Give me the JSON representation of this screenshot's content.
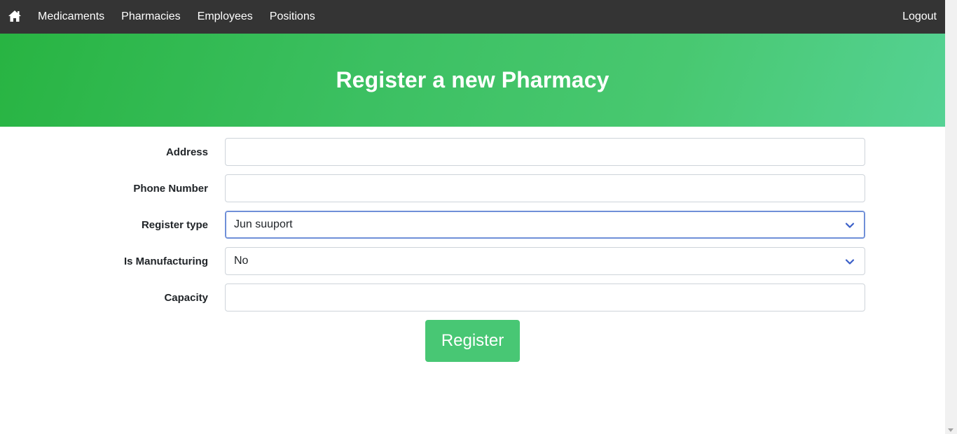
{
  "nav": {
    "home_icon": "home-icon",
    "links": [
      "Medicaments",
      "Pharmacies",
      "Employees",
      "Positions"
    ],
    "logout": "Logout"
  },
  "hero": {
    "title": "Register a new Pharmacy"
  },
  "form": {
    "address": {
      "label": "Address",
      "value": ""
    },
    "phone": {
      "label": "Phone Number",
      "value": ""
    },
    "register_type": {
      "label": "Register type",
      "selected": "Jun suuport"
    },
    "is_manufacturing": {
      "label": "Is Manufacturing",
      "selected": "No"
    },
    "capacity": {
      "label": "Capacity",
      "value": ""
    },
    "submit_label": "Register"
  },
  "colors": {
    "navbar": "#343434",
    "hero_start": "#28b442",
    "hero_end": "#55d294",
    "button": "#48c774",
    "focus": "#6f8fd8"
  }
}
